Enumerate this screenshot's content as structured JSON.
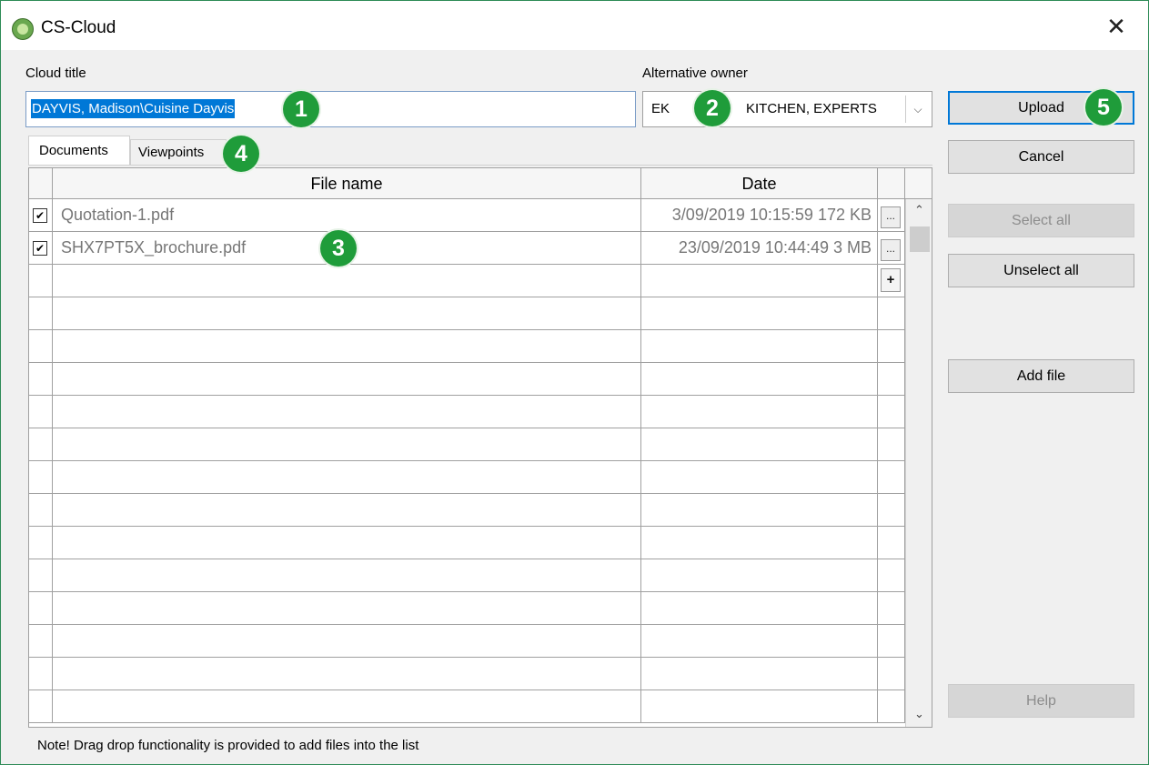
{
  "window": {
    "title": "CS-Cloud",
    "close_glyph": "✕"
  },
  "form": {
    "cloud_title_label": "Cloud title",
    "cloud_title_value": "DAYVIS, Madison\\Cuisine Dayvis",
    "alt_owner_label": "Alternative owner",
    "alt_owner_code": "EK",
    "alt_owner_name": "KITCHEN, EXPERTS"
  },
  "tabs": [
    {
      "label": "Documents",
      "active": true
    },
    {
      "label": "Viewpoints",
      "active": false
    }
  ],
  "table": {
    "columns": [
      "File name",
      "Date"
    ],
    "rows": [
      {
        "checked": true,
        "name": "Quotation-1.pdf",
        "date": "3/09/2019 10:15:59  172 KB",
        "action": "..."
      },
      {
        "checked": true,
        "name": "SHX7PT5X_brochure.pdf",
        "date": "23/09/2019 10:44:49    3 MB",
        "action": "..."
      }
    ],
    "add_row_glyph": "+",
    "check_glyph": "✔"
  },
  "buttons": {
    "upload": "Upload",
    "cancel": "Cancel",
    "select_all": "Select all",
    "unselect_all": "Unselect all",
    "add_file": "Add file",
    "help": "Help"
  },
  "callouts": [
    "1",
    "2",
    "3",
    "4",
    "5"
  ],
  "note": "Note! Drag  drop functionality is provided to add files into the list",
  "icons": {
    "app": "cs-cloud-logo-icon",
    "combo_arrow": "chevron-down-icon",
    "scroll_up": "chevron-up-icon",
    "scroll_down": "chevron-down-icon"
  },
  "colors": {
    "accent": "#0078d7",
    "badge": "#1f9c3a",
    "window_border": "#2e8b57"
  }
}
